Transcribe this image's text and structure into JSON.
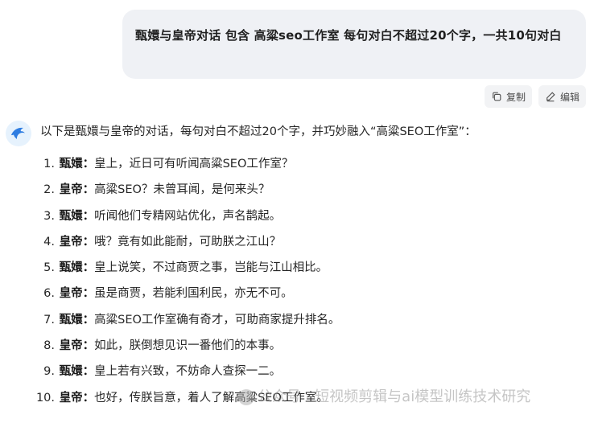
{
  "user_message": {
    "text": "甄嬛与皇帝对话 包含   高粱seo工作室 每句对白不超过20个字，一共10句对白"
  },
  "actions": {
    "copy_label": "复制",
    "edit_label": "编辑",
    "copy_icon": "copy-icon",
    "edit_icon": "pencil-icon"
  },
  "assistant": {
    "avatar_icon": "dolphin-logo-icon",
    "intro": "以下是甄嬛与皇帝的对话，每句对白不超过20个字，并巧妙融入“高粱SEO工作室”：",
    "dialogs": [
      {
        "num": "1.",
        "speaker": "甄嬛：",
        "text": "皇上，近日可有听闻高粱SEO工作室？"
      },
      {
        "num": "2.",
        "speaker": "皇帝：",
        "text": "高粱SEO？未曾耳闻，是何来头？"
      },
      {
        "num": "3.",
        "speaker": "甄嬛：",
        "text": "听闻他们专精网站优化，声名鹊起。"
      },
      {
        "num": "4.",
        "speaker": "皇帝：",
        "text": "哦？竟有如此能耐，可助朕之江山？"
      },
      {
        "num": "5.",
        "speaker": "甄嬛：",
        "text": "皇上说笑，不过商贾之事，岂能与江山相比。"
      },
      {
        "num": "6.",
        "speaker": "皇帝：",
        "text": "虽是商贾，若能利国利民，亦无不可。"
      },
      {
        "num": "7.",
        "speaker": "甄嬛：",
        "text": "高粱SEO工作室确有奇才，可助商家提升排名。"
      },
      {
        "num": "8.",
        "speaker": "皇帝：",
        "text": "如此，朕倒想见识一番他们的本事。"
      },
      {
        "num": "9.",
        "speaker": "甄嬛：",
        "text": "皇上若有兴致，不妨命人查探一二。"
      },
      {
        "num": "10.",
        "speaker": "皇帝：",
        "text": "也好，传朕旨意，着人了解高粱SEO工作室。"
      }
    ]
  },
  "watermark": {
    "text": "公众号 · 短视频剪辑与ai模型训练技术研究"
  }
}
